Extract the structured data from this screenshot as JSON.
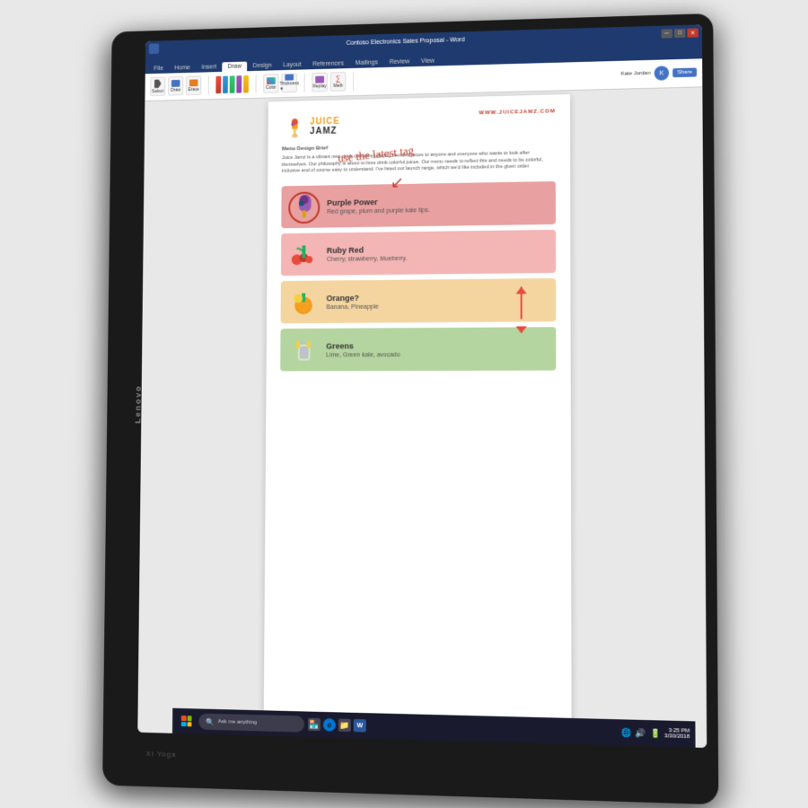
{
  "laptop": {
    "brand": "Lenovo",
    "model": "XI Yoga"
  },
  "titlebar": {
    "title": "Contoso Electronics Sales Proposal - Word",
    "user": "Kate Jordan",
    "tabs": [
      "File",
      "Home",
      "Insert",
      "Draw",
      "Design",
      "Layout",
      "References",
      "Mailings",
      "Review",
      "View"
    ],
    "active_tab": "Draw"
  },
  "document": {
    "logo": {
      "juice": "JUICE",
      "jamz": "JAMZ",
      "website": "WWW.JUICEJAMZ.COM"
    },
    "annotation": "use the latest tag",
    "section_title": "Menu Design Brief",
    "body_text": "Juice Jamz is a vibrant new drink company offering blended juices to anyone and everyone who wants to look after themselves. Our philosophy is about to lives drink colorful juices. Our menu needs to reflect this and needs to be colorful, inclusive and of course easy to understand. I've listed our launch range, which we'd like included in the given order.",
    "menu_items": [
      {
        "id": "purple-power",
        "title": "Purple Power",
        "description": "Red grape, plum and purple kale tips.",
        "color_class": "purple",
        "icon": "🫐",
        "has_circle": true
      },
      {
        "id": "ruby-red",
        "title": "Ruby Red",
        "description": "Cherry, strawberry, blueberry.",
        "color_class": "red",
        "icon": "🍓"
      },
      {
        "id": "orange",
        "title": "Orange?",
        "description": "Banana, Pineapple",
        "color_class": "orange",
        "icon": "🍍",
        "has_arrows": true
      },
      {
        "id": "greens",
        "title": "Greens",
        "description": "Lime, Green kale, avocado",
        "color_class": "green",
        "icon": "🥤"
      }
    ]
  },
  "taskbar": {
    "search_placeholder": "Ask me anything",
    "time": "3:25 PM",
    "date": "3/30/2018",
    "icons": [
      "💻",
      "🌐",
      "📁"
    ]
  }
}
